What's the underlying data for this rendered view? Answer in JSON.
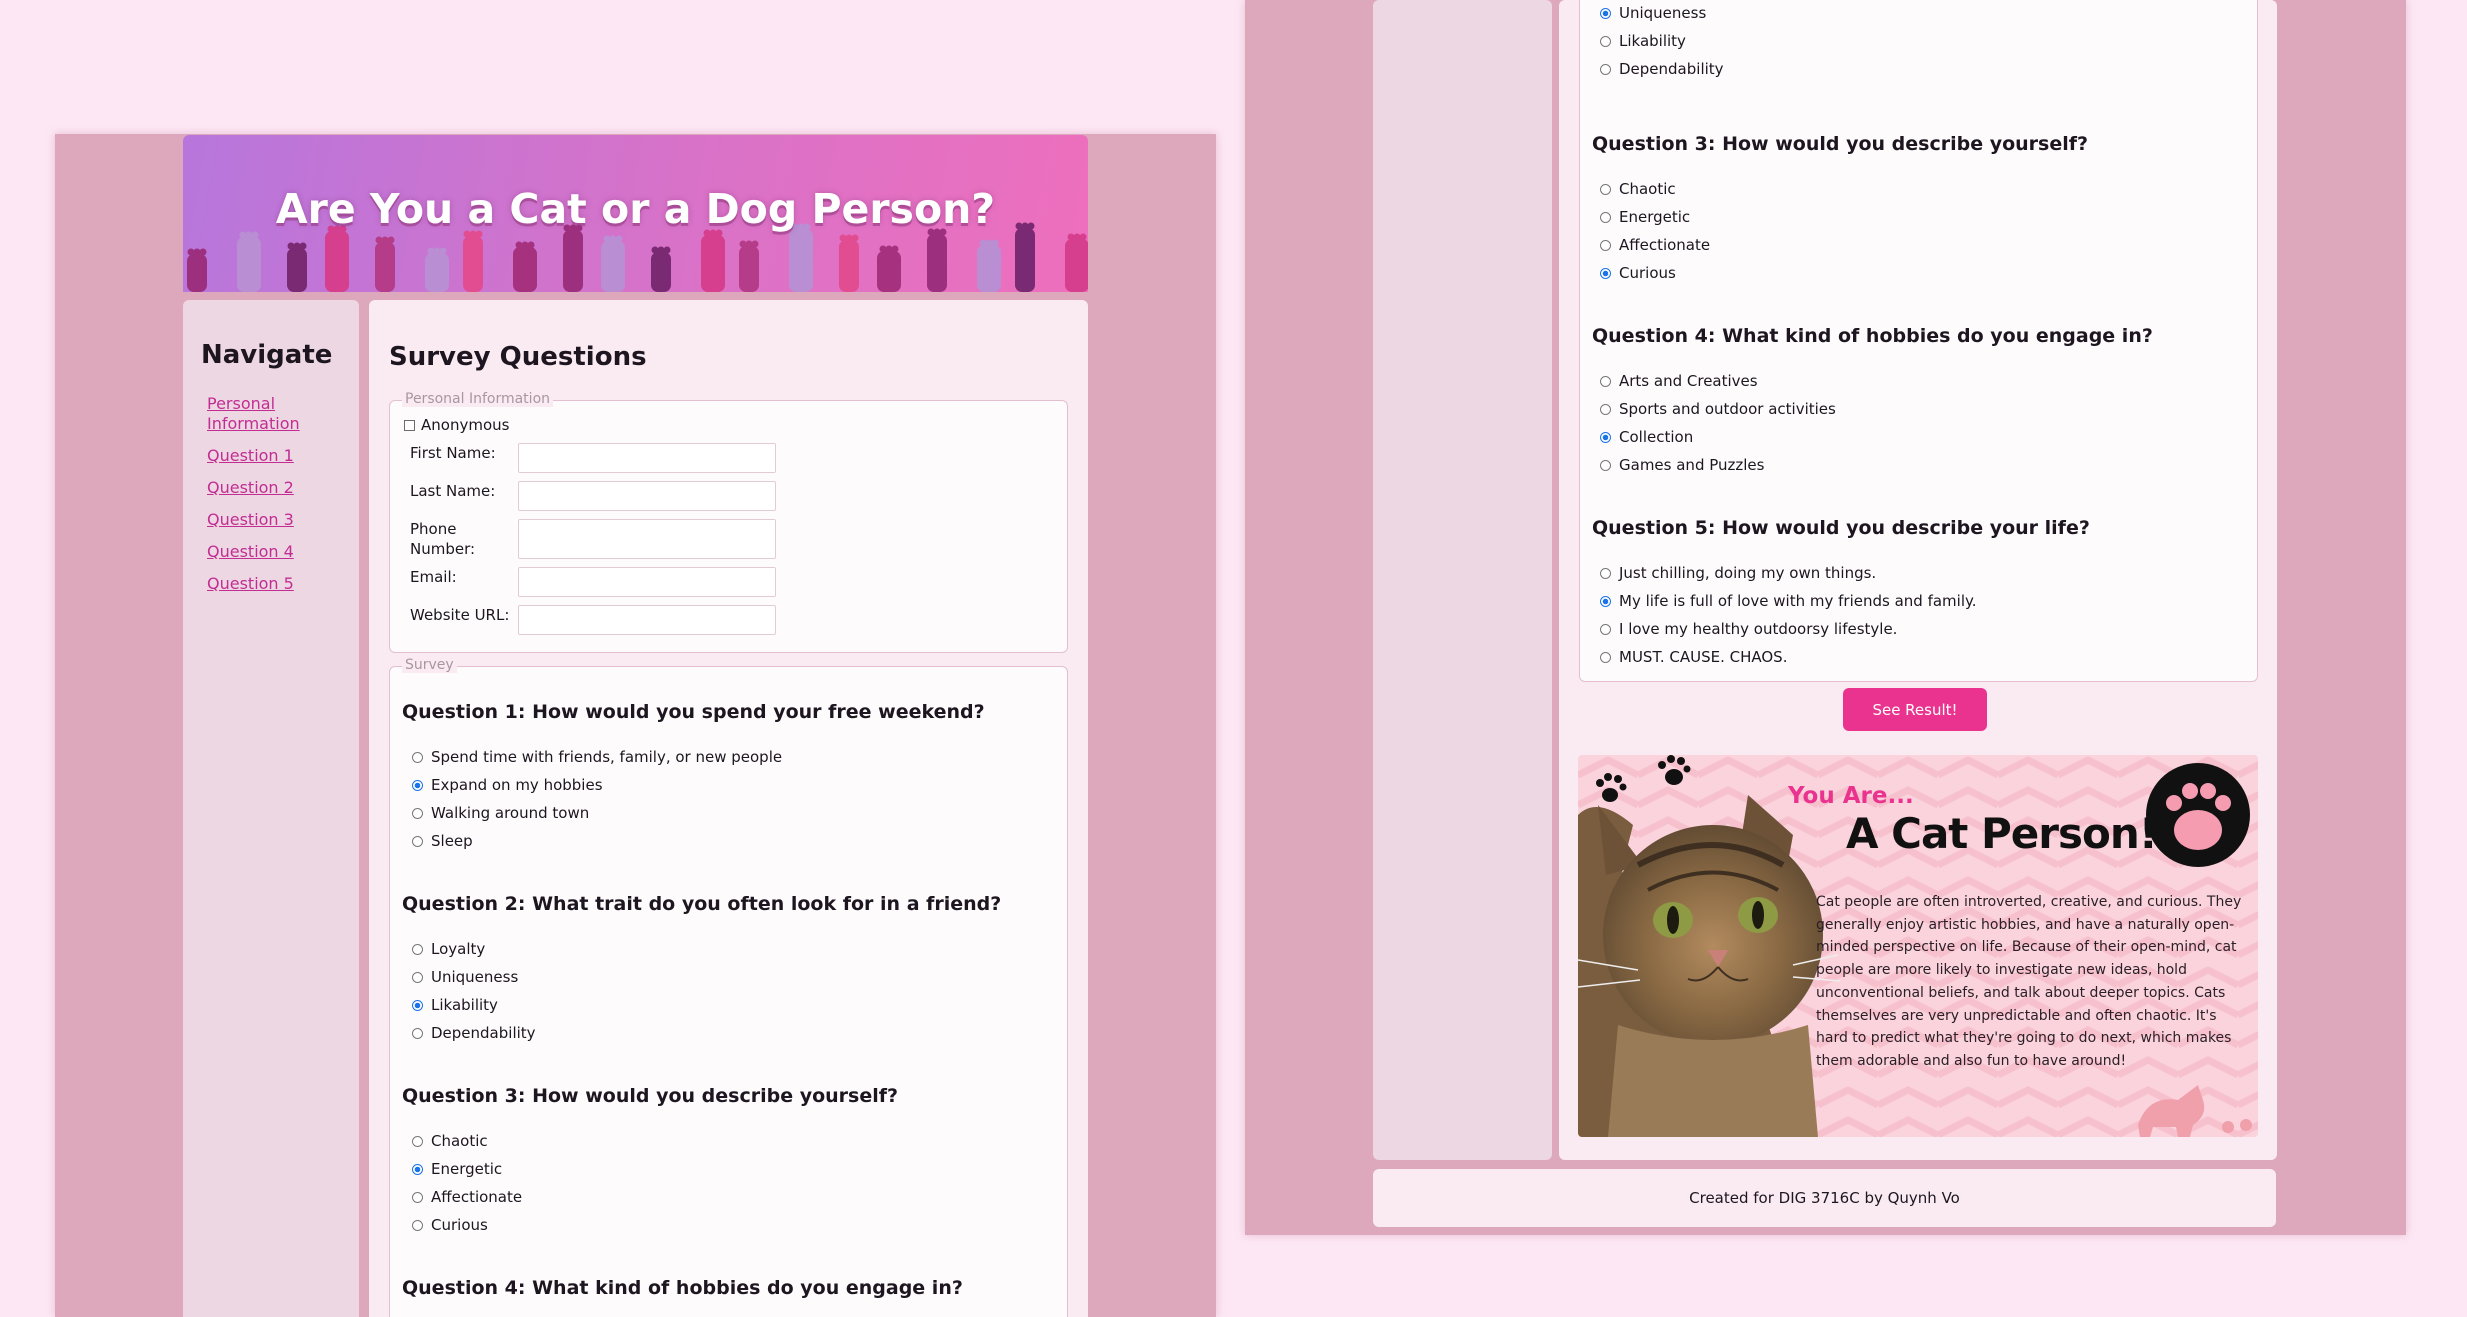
{
  "header": {
    "title": "Are You a Cat or a Dog Person?"
  },
  "nav": {
    "heading": "Navigate",
    "links": [
      "Personal Information",
      "Question 1",
      "Question 2",
      "Question 3",
      "Question 4",
      "Question 5"
    ]
  },
  "main": {
    "heading": "Survey Questions"
  },
  "personal": {
    "legend": "Personal Information",
    "anonymous_label": "Anonymous",
    "fields": [
      {
        "label": "First Name:",
        "value": ""
      },
      {
        "label": "Last Name:",
        "value": ""
      },
      {
        "label": "Phone Number:",
        "value": ""
      },
      {
        "label": "Email:",
        "value": ""
      },
      {
        "label": "Website URL:",
        "value": ""
      }
    ]
  },
  "survey": {
    "legend": "Survey"
  },
  "left_questions": [
    {
      "title": "Question 1: How would you spend your free weekend?",
      "options": [
        "Spend time with friends, family, or new people",
        "Expand on my hobbies",
        "Walking around town",
        "Sleep"
      ],
      "selected": 1
    },
    {
      "title": "Question 2: What trait do you often look for in a friend?",
      "options": [
        "Loyalty",
        "Uniqueness",
        "Likability",
        "Dependability"
      ],
      "selected": 2
    },
    {
      "title": "Question 3: How would you describe yourself?",
      "options": [
        "Chaotic",
        "Energetic",
        "Affectionate",
        "Curious"
      ],
      "selected": 1
    },
    {
      "title": "Question 4: What kind of hobbies do you engage in?",
      "options": [],
      "selected": -1
    }
  ],
  "right_q2_tail": {
    "options": [
      "Uniqueness",
      "Likability",
      "Dependability"
    ],
    "selected": 0
  },
  "right_questions": [
    {
      "title": "Question 3: How would you describe yourself?",
      "options": [
        "Chaotic",
        "Energetic",
        "Affectionate",
        "Curious"
      ],
      "selected": 3
    },
    {
      "title": "Question 4: What kind of hobbies do you engage in?",
      "options": [
        "Arts and Creatives",
        "Sports and outdoor activities",
        "Collection",
        "Games and Puzzles"
      ],
      "selected": 2
    },
    {
      "title": "Question 5: How would you describe your life?",
      "options": [
        "Just chilling, doing my own things.",
        "My life is full of love with my friends and family.",
        "I love my healthy outdoorsy lifestyle.",
        "MUST. CAUSE. CHAOS."
      ],
      "selected": 1
    }
  ],
  "result": {
    "button_label": "See Result!",
    "you_are": "You Are...",
    "headline": "A Cat Person!",
    "description": "Cat people are often introverted, creative, and curious. They generally enjoy artistic hobbies, and have a naturally open-minded perspective on life. Because of their open-mind, cat people are more likely to investigate new ideas, hold unconventional beliefs, and talk about deeper topics. Cats themselves are very unpredictable and often chaotic. It's hard to predict what they're going to do next, which makes them adorable and also fun to have around!"
  },
  "footer": {
    "text": "Created for DIG 3716C by Quynh Vo"
  },
  "colors": {
    "accent": "#ea338f",
    "link": "#c32d93",
    "radio_checked": "#1a73e8",
    "page_bg": "#fde7f4",
    "panel_bg": "#dda8bc"
  }
}
